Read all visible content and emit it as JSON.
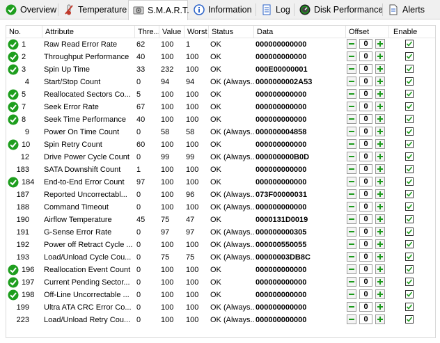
{
  "tabs": [
    {
      "label": "Overview",
      "icon": "checkmark-circle-icon"
    },
    {
      "label": "Temperature",
      "icon": "thermometer-icon"
    },
    {
      "label": "S.M.A.R.T.",
      "icon": "smart-disk-icon"
    },
    {
      "label": "Information",
      "icon": "info-icon"
    },
    {
      "label": "Log",
      "icon": "log-book-icon"
    },
    {
      "label": "Disk Performance",
      "icon": "gauge-icon"
    },
    {
      "label": "Alerts",
      "icon": "alerts-page-icon"
    }
  ],
  "columns": {
    "no": "No.",
    "attribute": "Attribute",
    "threshold": "Thre...",
    "value": "Value",
    "worst": "Worst",
    "status": "Status",
    "data": "Data",
    "offset": "Offset",
    "enable": "Enable"
  },
  "colors": {
    "ok_green": "#1e9e1e",
    "control_green": "#1a9a1a"
  },
  "rows": [
    {
      "no": "1",
      "attr": "Raw Read Error Rate",
      "thr": "62",
      "val": "100",
      "worst": "1",
      "status": "OK",
      "data": "000000000000",
      "offset": "0",
      "ok_icon": true
    },
    {
      "no": "2",
      "attr": "Throughput Performance",
      "thr": "40",
      "val": "100",
      "worst": "100",
      "status": "OK",
      "data": "000000000000",
      "offset": "0",
      "ok_icon": true
    },
    {
      "no": "3",
      "attr": "Spin Up Time",
      "thr": "33",
      "val": "232",
      "worst": "100",
      "status": "OK",
      "data": "000E00000001",
      "offset": "0",
      "ok_icon": true
    },
    {
      "no": "4",
      "attr": "Start/Stop Count",
      "thr": "0",
      "val": "94",
      "worst": "94",
      "status": "OK (Always...",
      "data": "0000000002A53",
      "offset": "0",
      "ok_icon": false
    },
    {
      "no": "5",
      "attr": "Reallocated Sectors Co...",
      "thr": "5",
      "val": "100",
      "worst": "100",
      "status": "OK",
      "data": "000000000000",
      "offset": "0",
      "ok_icon": true
    },
    {
      "no": "7",
      "attr": "Seek Error Rate",
      "thr": "67",
      "val": "100",
      "worst": "100",
      "status": "OK",
      "data": "000000000000",
      "offset": "0",
      "ok_icon": true
    },
    {
      "no": "8",
      "attr": "Seek Time Performance",
      "thr": "40",
      "val": "100",
      "worst": "100",
      "status": "OK",
      "data": "000000000000",
      "offset": "0",
      "ok_icon": true
    },
    {
      "no": "9",
      "attr": "Power On Time Count",
      "thr": "0",
      "val": "58",
      "worst": "58",
      "status": "OK (Always...",
      "data": "000000004858",
      "offset": "0",
      "ok_icon": false
    },
    {
      "no": "10",
      "attr": "Spin Retry Count",
      "thr": "60",
      "val": "100",
      "worst": "100",
      "status": "OK",
      "data": "000000000000",
      "offset": "0",
      "ok_icon": true
    },
    {
      "no": "12",
      "attr": "Drive Power Cycle Count",
      "thr": "0",
      "val": "99",
      "worst": "99",
      "status": "OK (Always...",
      "data": "000000000B0D",
      "offset": "0",
      "ok_icon": false
    },
    {
      "no": "183",
      "attr": "SATA Downshift Count",
      "thr": "1",
      "val": "100",
      "worst": "100",
      "status": "OK",
      "data": "000000000000",
      "offset": "0",
      "ok_icon": false
    },
    {
      "no": "184",
      "attr": "End-to-End Error Count",
      "thr": "97",
      "val": "100",
      "worst": "100",
      "status": "OK",
      "data": "000000000000",
      "offset": "0",
      "ok_icon": true
    },
    {
      "no": "187",
      "attr": "Reported Uncorrectabl...",
      "thr": "0",
      "val": "100",
      "worst": "96",
      "status": "OK (Always...",
      "data": "073F00000031",
      "offset": "0",
      "ok_icon": false
    },
    {
      "no": "188",
      "attr": "Command Timeout",
      "thr": "0",
      "val": "100",
      "worst": "100",
      "status": "OK (Always...",
      "data": "000000000000",
      "offset": "0",
      "ok_icon": false
    },
    {
      "no": "190",
      "attr": "Airflow Temperature",
      "thr": "45",
      "val": "75",
      "worst": "47",
      "status": "OK",
      "data": "0000131D0019",
      "offset": "0",
      "ok_icon": false
    },
    {
      "no": "191",
      "attr": "G-Sense Error Rate",
      "thr": "0",
      "val": "97",
      "worst": "97",
      "status": "OK (Always...",
      "data": "000000000305",
      "offset": "0",
      "ok_icon": false
    },
    {
      "no": "192",
      "attr": "Power off Retract Cycle ...",
      "thr": "0",
      "val": "100",
      "worst": "100",
      "status": "OK (Always...",
      "data": "000000550055",
      "offset": "0",
      "ok_icon": false
    },
    {
      "no": "193",
      "attr": "Load/Unload Cycle Cou...",
      "thr": "0",
      "val": "75",
      "worst": "75",
      "status": "OK (Always...",
      "data": "00000003DB8C",
      "offset": "0",
      "ok_icon": false
    },
    {
      "no": "196",
      "attr": "Reallocation Event Count",
      "thr": "0",
      "val": "100",
      "worst": "100",
      "status": "OK",
      "data": "000000000000",
      "offset": "0",
      "ok_icon": true
    },
    {
      "no": "197",
      "attr": "Current Pending Sector...",
      "thr": "0",
      "val": "100",
      "worst": "100",
      "status": "OK",
      "data": "000000000000",
      "offset": "0",
      "ok_icon": true
    },
    {
      "no": "198",
      "attr": "Off-Line Uncorrectable ...",
      "thr": "0",
      "val": "100",
      "worst": "100",
      "status": "OK",
      "data": "000000000000",
      "offset": "0",
      "ok_icon": true
    },
    {
      "no": "199",
      "attr": "Ultra ATA CRC Error Co...",
      "thr": "0",
      "val": "100",
      "worst": "100",
      "status": "OK (Always...",
      "data": "000000000000",
      "offset": "0",
      "ok_icon": false
    },
    {
      "no": "223",
      "attr": "Load/Unload Retry Cou...",
      "thr": "0",
      "val": "100",
      "worst": "100",
      "status": "OK (Always...",
      "data": "000000000000",
      "offset": "0",
      "ok_icon": false
    }
  ]
}
